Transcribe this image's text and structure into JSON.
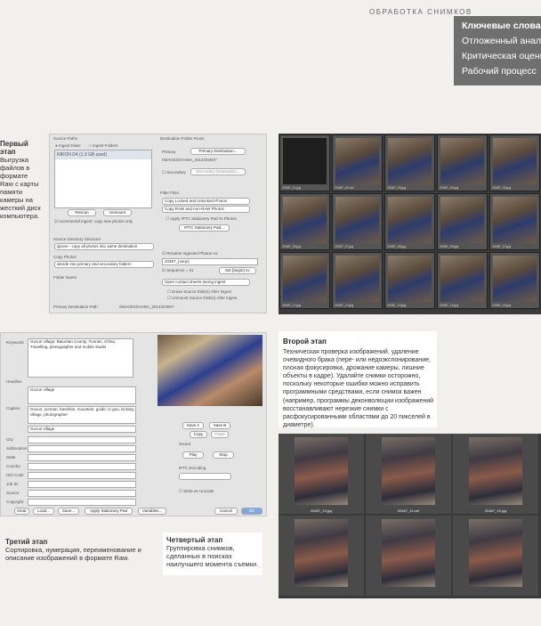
{
  "header": {
    "title": "ОБРАБОТКА СНИМКОВ"
  },
  "keywords": {
    "items": [
      "Ключевые слова",
      "Отложенный анализ",
      "Критическая оценка",
      "Рабочий процесс"
    ]
  },
  "stage1": {
    "title": "Первый этап",
    "text": "Выгрузка файлов в формате Raw с карты памяти камеры на жесткий диск компьютера."
  },
  "stage2": {
    "title": "Второй этап",
    "text": "Техническая проверка изображений, удаление очевидного брака (пере- или недоэкспонирование, плохая фокусировка, дрожание камеры, лишние объекты в кадре). Удаляйте снимки осторожно, поскольку некоторые ошибки можно исправить программными средствами, если снимок важен (например, программы деконволюции изображений восстанавливают нерезкие снимки с расфокусированными областями до 20 пикселей в диаметре)."
  },
  "stage3": {
    "title": "Третий этап",
    "text": "Сортировка, нумерация, переименование и описание изображений в формате Raw."
  },
  "stage4": {
    "title": "Четвертый этап",
    "text": "Группировка снимков, сделанных в поисках наилучшего момента съемки."
  },
  "import_dialog": {
    "source_paths": "Source Paths",
    "ingest_disks": "Ingest Disks",
    "ingest_folders": "Ingest Folders",
    "disk": "NIKON D4   (1.9 GB used)",
    "rescan": "Rescan",
    "unmount": "Unmount",
    "incremental": "Incremental Ingest: copy new photos only",
    "dest_roots": "Destination Folder Roots",
    "primary": "Primary",
    "primary_btn": "Primary Destination...",
    "primary_path": "/IMAGES/CHINA_2014/20487/",
    "secondary": "Secondary",
    "secondary_btn": "Secondary Destination...",
    "filter_files": "Filter Files:",
    "filter1": "Copy Locked and Unlocked Photos",
    "filter2": "Copy RAW and non-RAW Photos",
    "apply_iptc": "Apply IPTC Stationery Pad To Photos",
    "iptc_pad": "IPTC Stationery Pad...",
    "src_dir": "Source Directory Structure",
    "src_dir_val": "ignore - copy all photos into same destination",
    "copy_photos": "Copy Photos",
    "copy_photos_val": "decide into primary and secondary folders",
    "folder_name": "Folder Name",
    "rename": "Rename Ingested Photos As:",
    "rename_val": "20487_{seqn}",
    "sequence": "Sequence = 01",
    "set_begin": "Set {begin} to:",
    "open_contact": "Open contact sheets during ingest",
    "erase": "Erase Source Disk(s) After Ingest",
    "unmount_after": "Unmount Source Disk(s) After Ingest",
    "primary_path_label": "Primary Destination Path",
    "primary_path_val": "/IMAGES/CHINA_2014/20487/"
  },
  "iptc_dialog": {
    "keywords": "Keywords",
    "keywords_val": "Gucun village, Batuotan County, Yunnan, China, Travelling, photographer and mobile studio",
    "headline": "Headline",
    "caption_val": "Gucun village",
    "caption_label": "Caption",
    "details_val": "Gucun, yunnan, baoshan, mountain, guide, lu guo, kicking, village, photographer",
    "row_labels": [
      "City",
      "Sublocation",
      "State",
      "Country",
      "ISO Code",
      "Job ID",
      "Source",
      "Copyright"
    ],
    "city_val": "Gucun village",
    "save_a": "Save A",
    "save_b": "Save B",
    "copy": "Copy",
    "paste": "Paste",
    "sound": "Sound",
    "play": "Play",
    "stop": "Stop",
    "iptc_encoding": "IPTC Encoding",
    "write_unicode": "Write as Unicode",
    "clear": "Clear",
    "load": "Load...",
    "save": "Save...",
    "apply_pad": "Apply Stationery Pad",
    "variables": "Variables...",
    "cancel": "Cancel",
    "ok": "OK"
  },
  "contact_sheet": {
    "labels": [
      "20487_01.jpg",
      "20487_02.nef",
      "20487_03.jpg",
      "20487_04.jpg",
      "20487_05.jpg",
      "20487_06.jpg",
      "20487_07.jpg",
      "20487_08.jpg",
      "20487_09.jpg",
      "20487_10.jpg",
      "20487_11.jpg",
      "20487_12.jpg",
      "20487_13.jpg",
      "20487_14.jpg",
      "20487_15.jpg"
    ]
  },
  "preview_sheet": {
    "labels": [
      "20487_13.jpg",
      "20487_14.nef",
      "20487_15.jpg"
    ]
  }
}
